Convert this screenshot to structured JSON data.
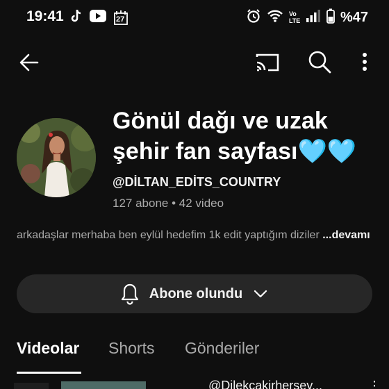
{
  "status_bar": {
    "time": "19:41",
    "battery": "%47",
    "calendar_day": "27",
    "network": "Vo LTE"
  },
  "toolbar": {
    "back_icon": "arrow-left-icon",
    "cast_icon": "cast-icon",
    "search_icon": "search-icon",
    "more_icon": "more-vert-icon"
  },
  "channel": {
    "title": "Gönül dağı ve uzak şehir fan sayfası🩵🩵",
    "handle": "@DİLTAN_EDİTS_COUNTRY",
    "subscribers": "127 abone",
    "separator": "•",
    "videos": "42 video",
    "description": "arkadaşlar merhaba ben eylül hedefim 1k edit yaptığım diziler ",
    "more_label": "...devamı"
  },
  "subscribe": {
    "label": "Abone olundu",
    "bell_icon": "bell-icon",
    "chevron_icon": "chevron-down-icon"
  },
  "tabs": [
    {
      "label": "Videolar",
      "active": true
    },
    {
      "label": "Shorts",
      "active": false
    },
    {
      "label": "Gönderiler",
      "active": false
    }
  ],
  "video_peek": {
    "title": "@Dilekcakirhersey..."
  },
  "colors": {
    "background": "#0f0f0f",
    "button_bg": "#272727",
    "secondary_text": "#aaaaaa",
    "primary_text": "#f1f1f1"
  }
}
